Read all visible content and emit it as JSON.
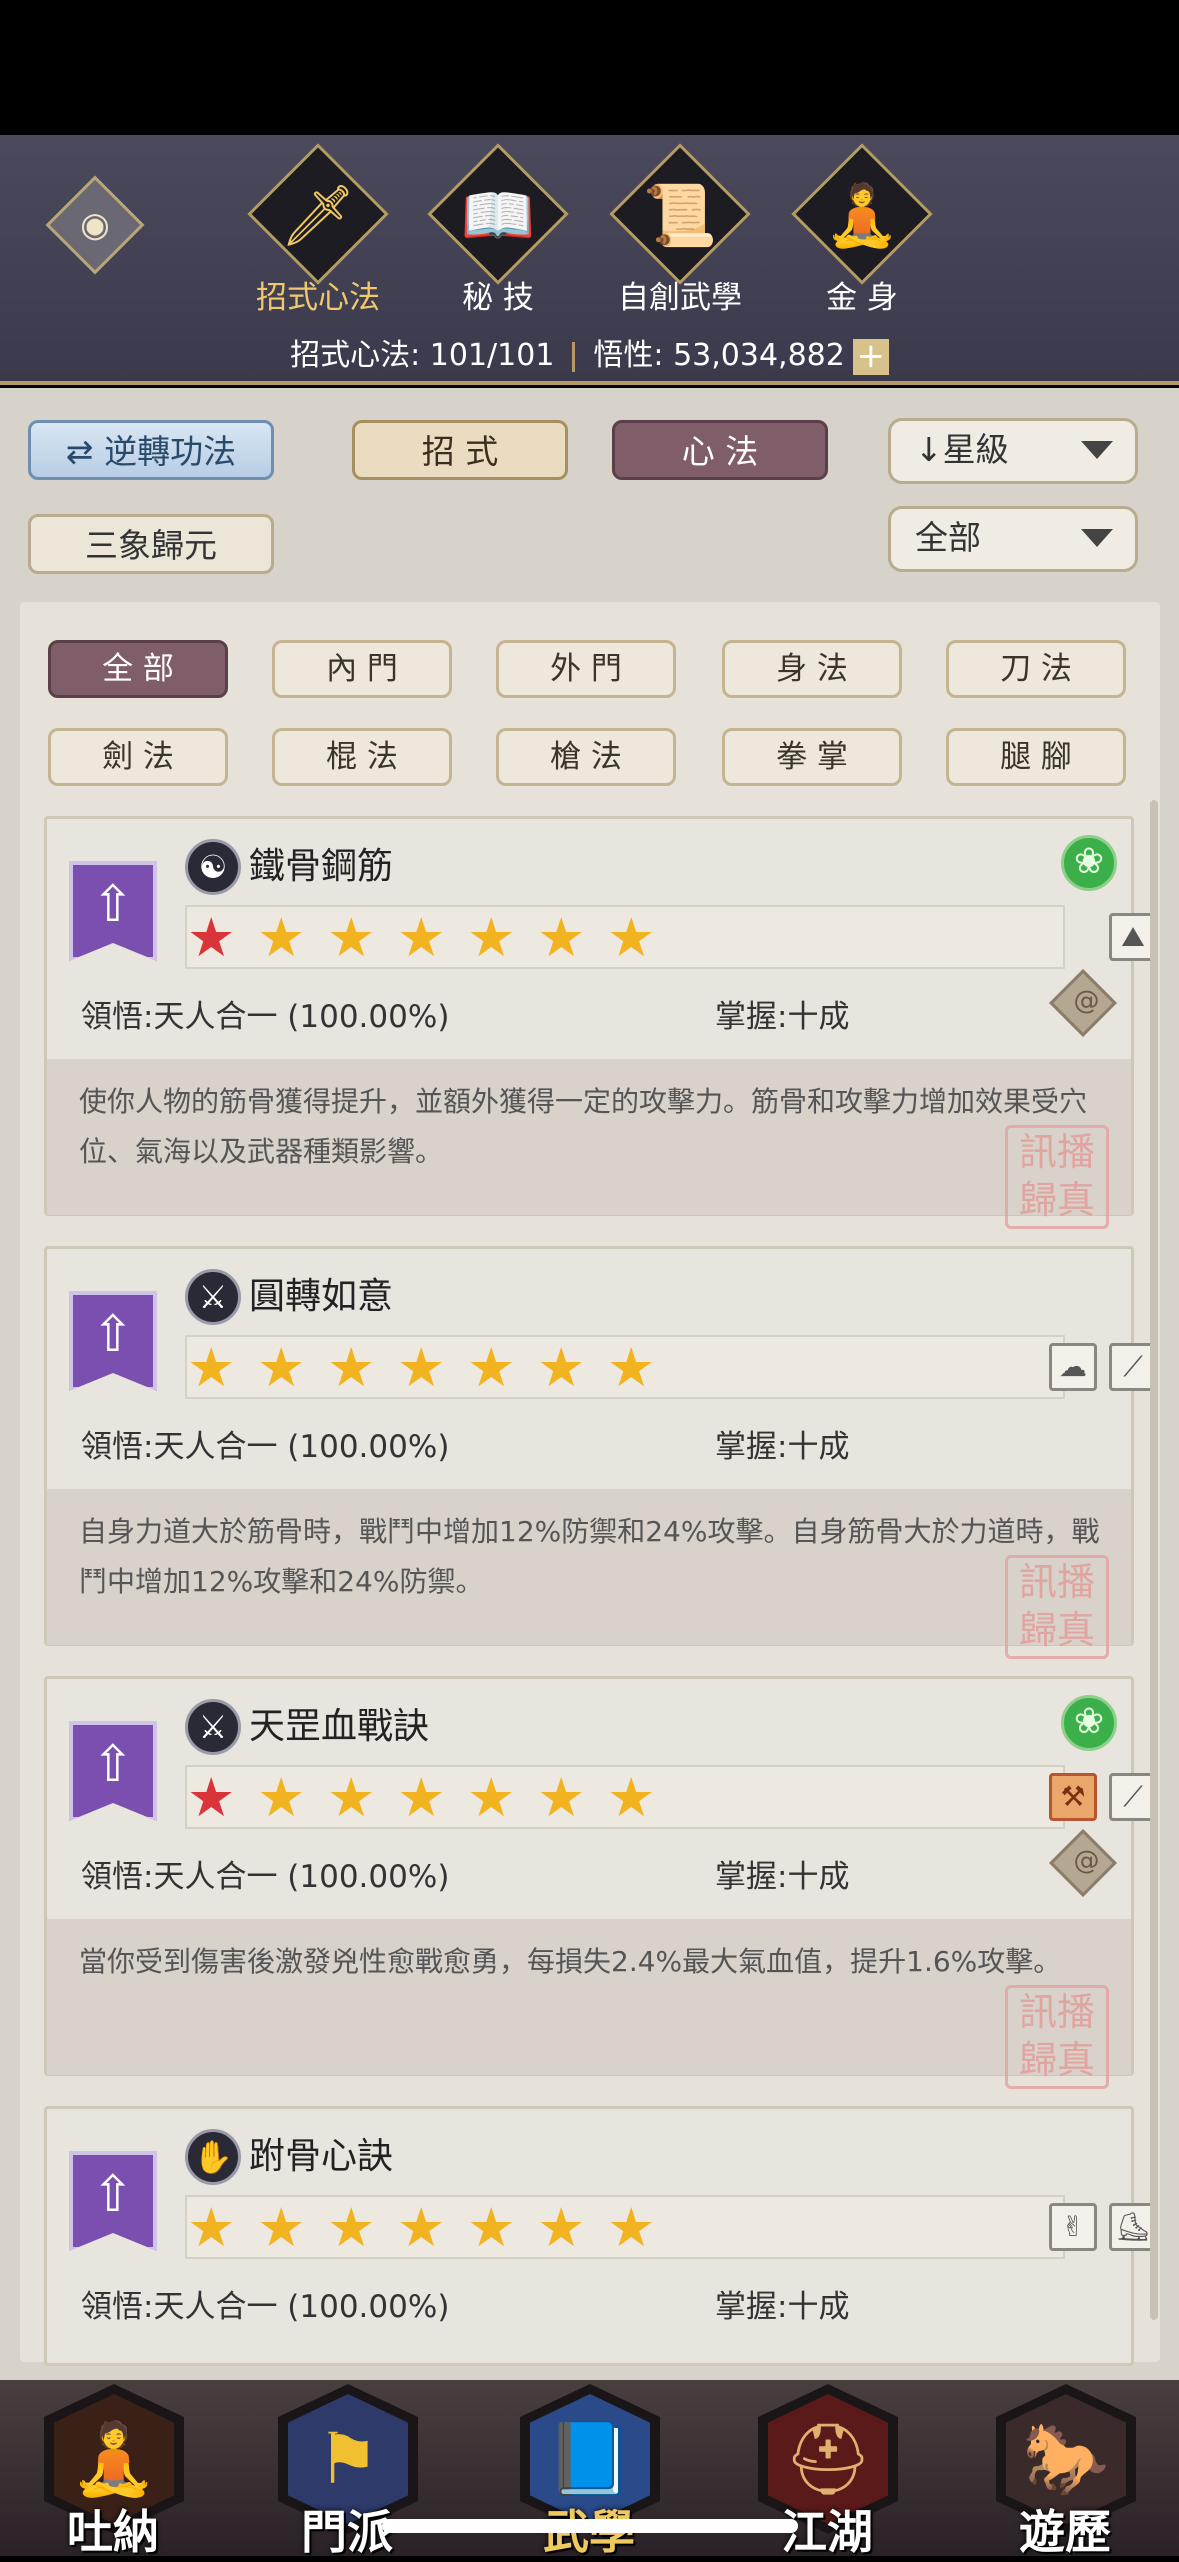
{
  "header": {
    "tabs": [
      {
        "label": "招式心法",
        "icon": "sword-icon",
        "active": true
      },
      {
        "label": "秘 技",
        "icon": "book-icon",
        "active": false
      },
      {
        "label": "自創武學",
        "icon": "scroll-icon",
        "active": false
      },
      {
        "label": "金 身",
        "icon": "meditation-icon",
        "active": false
      }
    ],
    "stats": {
      "progress_label": "招式心法: 101/101",
      "insight_label": "悟性: 53,034,882"
    }
  },
  "controls": {
    "reverse_label": "逆轉功法",
    "moves_label": "招 式",
    "mind_label": "心 法",
    "sort_label": "↓星級",
    "preset_label": "三象歸元",
    "filter_all_label": "全部"
  },
  "filters": [
    "全 部",
    "內 門",
    "外 門",
    "身 法",
    "刀 法",
    "劍 法",
    "棍 法",
    "槍 法",
    "拳 掌",
    "腿 腳"
  ],
  "selected_filter": "全 部",
  "cards": [
    {
      "name": "鐵骨鋼筋",
      "icon": "yin-yang-icon",
      "stars": 7,
      "red_star": true,
      "insight": "領悟:天人合一 (100.00%)",
      "mastery": "掌握:十成",
      "description": "使你人物的筋骨獲得提升，並額外獲得一定的攻擊力。筋骨和攻擊力增加效果受穴位、氣海以及武器種類影響。",
      "has_green": true,
      "has_diamond": true
    },
    {
      "name": "圓轉如意",
      "icon": "spear-icon",
      "stars": 7,
      "red_star": false,
      "insight": "領悟:天人合一 (100.00%)",
      "mastery": "掌握:十成",
      "description": "自身力道大於筋骨時，戰鬥中增加12%防禦和24%攻擊。自身筋骨大於力道時，戰鬥中增加12%攻擊和24%防禦。",
      "has_green": false,
      "has_diamond": false
    },
    {
      "name": "天罡血戰訣",
      "icon": "spear-icon",
      "stars": 7,
      "red_star": true,
      "insight": "領悟:天人合一 (100.00%)",
      "mastery": "掌握:十成",
      "description": "當你受到傷害後激發兇性愈戰愈勇，每損失2.4%最大氣血值，提升1.6%攻擊。",
      "has_green": true,
      "has_diamond": true
    },
    {
      "name": "跗骨心訣",
      "icon": "claw-icon",
      "stars": 7,
      "red_star": false,
      "insight": "領悟:天人合一 (100.00%)",
      "mastery": "掌握:十成",
      "description": "",
      "has_green": false,
      "has_diamond": false
    }
  ],
  "bottom_nav": [
    {
      "label": "吐納",
      "icon": "monk-icon"
    },
    {
      "label": "門派",
      "icon": "sect-flags-icon"
    },
    {
      "label": "武學",
      "icon": "manual-icon",
      "active": true
    },
    {
      "label": "江湖",
      "icon": "straw-hat-icon"
    },
    {
      "label": "遊歷",
      "icon": "horse-icon"
    }
  ],
  "seal_text": "訊播歸真"
}
